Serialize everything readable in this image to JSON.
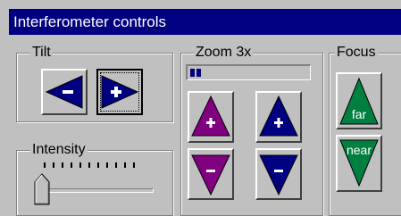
{
  "window": {
    "title": "Interferometer controls"
  },
  "groups": {
    "tilt": {
      "label": "Tilt"
    },
    "zoom": {
      "label": "Zoom 3x"
    },
    "focus": {
      "label": "Focus"
    },
    "intensity": {
      "label": "Intensity"
    }
  },
  "tilt": {
    "left": {
      "symbol": "−",
      "color": "#000080",
      "icon": "arrow-left-icon"
    },
    "right": {
      "symbol": "+",
      "color": "#000080",
      "icon": "arrow-right-icon",
      "pressed": true
    }
  },
  "zoom": {
    "purple_up": {
      "symbol": "+",
      "color": "#800080"
    },
    "purple_down": {
      "symbol": "−",
      "color": "#800080"
    },
    "navy_up": {
      "symbol": "+",
      "color": "#000080"
    },
    "navy_down": {
      "symbol": "−",
      "color": "#000080"
    },
    "progress_fraction": 0.04
  },
  "focus": {
    "far": {
      "label": "far",
      "color": "#008040"
    },
    "near": {
      "label": "near",
      "color": "#008040"
    }
  },
  "intensity": {
    "tick_count": 11,
    "level_fraction": 0.0
  }
}
